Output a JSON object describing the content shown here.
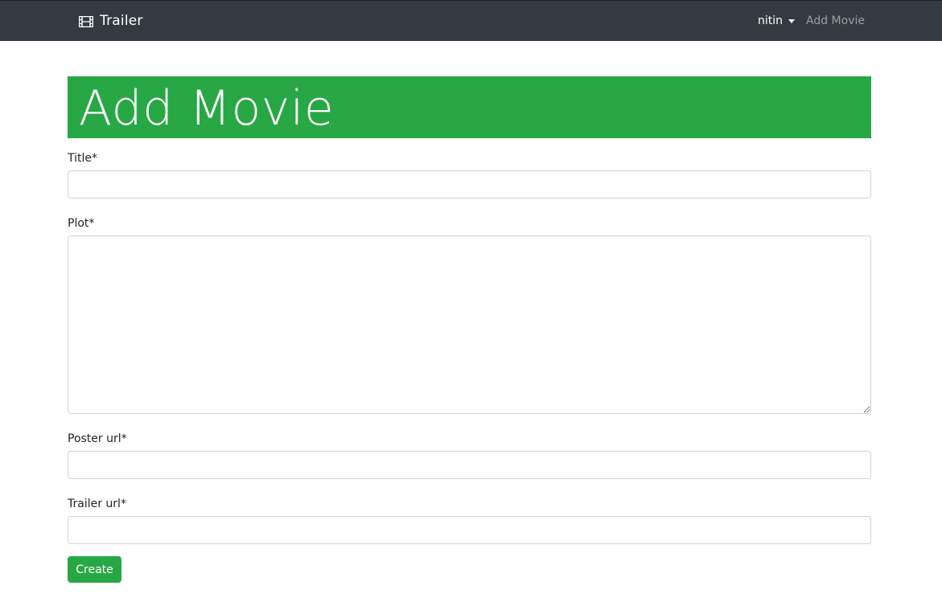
{
  "navbar": {
    "brand_label": "Trailer",
    "brand_icon": "film-icon",
    "user_label": "nitin",
    "add_movie_link": "Add Movie"
  },
  "page": {
    "title": "Add Movie"
  },
  "form": {
    "title_label": "Title",
    "plot_label": "Plot",
    "poster_label": "Poster url",
    "trailer_label": "Trailer url",
    "required_marker": "*",
    "title_value": "",
    "plot_value": "",
    "poster_value": "",
    "trailer_value": "",
    "submit_label": "Create"
  },
  "colors": {
    "navbar_bg": "#343a40",
    "accent_green": "#28a745",
    "nav_link_muted": "rgba(255,255,255,0.5)"
  }
}
